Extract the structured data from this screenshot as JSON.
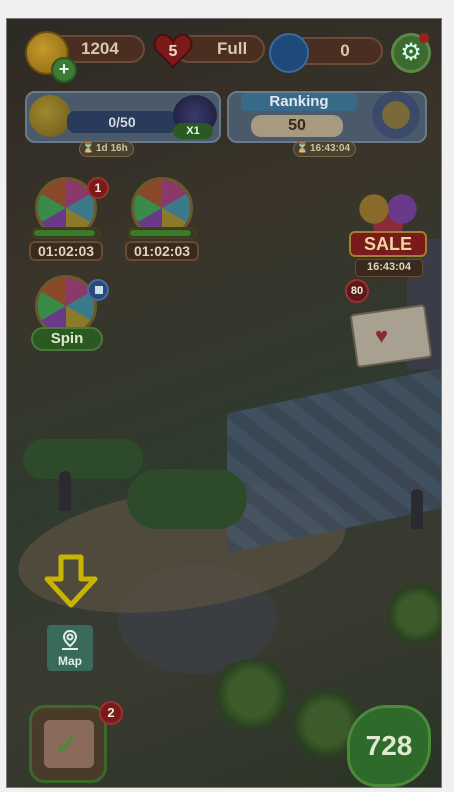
{
  "topbar": {
    "coins": "1204",
    "lives_count": "5",
    "lives_status": "Full",
    "gems": "0"
  },
  "progress_panel": {
    "progress": "0/50",
    "multiplier": "X1",
    "timer": "1d 16h"
  },
  "ranking_panel": {
    "title": "Ranking",
    "value": "50",
    "timer": "16:43:04"
  },
  "wheels": [
    {
      "timer": "01:02:03",
      "badge": "1"
    },
    {
      "timer": "01:02:03"
    },
    {
      "button": "Spin"
    }
  ],
  "sale": {
    "label": "SALE",
    "timer": "16:43:04"
  },
  "mail": {
    "count": "80"
  },
  "map_button": {
    "label": "Map"
  },
  "calendar_button": {
    "badge": "2"
  },
  "energy": {
    "value": "728"
  },
  "colors": {
    "overlay_dim": "#000000",
    "hint_arrow": "#c9b400",
    "map_button": "#3a6a5a",
    "badge_red": "#7a1a1a"
  }
}
